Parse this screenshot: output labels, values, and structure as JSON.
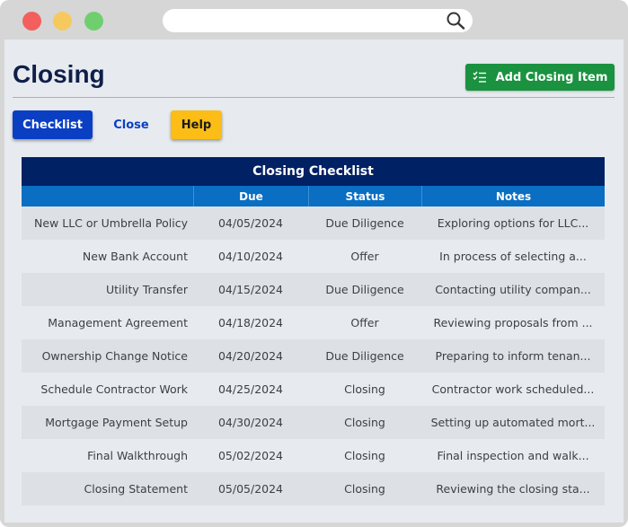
{
  "page": {
    "title": "Closing",
    "add_button_label": "Add Closing Item"
  },
  "tabs": [
    {
      "label": "Checklist"
    },
    {
      "label": "Close"
    },
    {
      "label": "Help"
    }
  ],
  "table": {
    "title": "Closing Checklist",
    "columns": [
      "",
      "Due",
      "Status",
      "Notes"
    ],
    "rows": [
      {
        "item": "New LLC or Umbrella Policy",
        "due": "04/05/2024",
        "status": "Due Diligence",
        "notes": "Exploring options for LLC..."
      },
      {
        "item": "New Bank Account",
        "due": "04/10/2024",
        "status": "Offer",
        "notes": "In process of selecting a..."
      },
      {
        "item": "Utility Transfer",
        "due": "04/15/2024",
        "status": "Due Diligence",
        "notes": "Contacting utility compan..."
      },
      {
        "item": "Management Agreement",
        "due": "04/18/2024",
        "status": "Offer",
        "notes": "Reviewing proposals from ..."
      },
      {
        "item": "Ownership Change Notice",
        "due": "04/20/2024",
        "status": "Due Diligence",
        "notes": "Preparing to inform tenan..."
      },
      {
        "item": "Schedule Contractor Work",
        "due": "04/25/2024",
        "status": "Closing",
        "notes": "Contractor work scheduled..."
      },
      {
        "item": "Mortgage Payment Setup",
        "due": "04/30/2024",
        "status": "Closing",
        "notes": "Setting up automated mort..."
      },
      {
        "item": "Final Walkthrough",
        "due": "05/02/2024",
        "status": "Closing",
        "notes": "Final inspection and walk..."
      },
      {
        "item": "Closing Statement",
        "due": "05/05/2024",
        "status": "Closing",
        "notes": "Reviewing the closing sta..."
      }
    ]
  },
  "icons": {
    "search": "search-icon",
    "add": "checklist-icon"
  },
  "colors": {
    "primary": "#0a3fc4",
    "success": "#1a9240",
    "warning": "#fbbd16",
    "header_dark": "#002164",
    "header_light": "#0a6ec3"
  }
}
